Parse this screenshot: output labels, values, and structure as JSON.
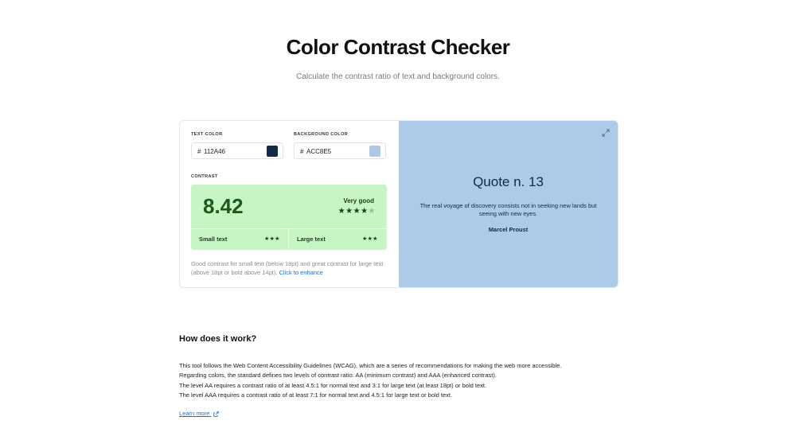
{
  "header": {
    "title": "Color Contrast Checker",
    "subtitle": "Calculate the contrast ratio of text and background colors."
  },
  "inputs": {
    "text_color_label": "TEXT COLOR",
    "text_color_hash": "#",
    "text_color_value": "112A46",
    "text_color_swatch": "#112a46",
    "background_color_label": "BACKGROUND COLOR",
    "background_color_hash": "#",
    "background_color_value": "ACC8E5",
    "background_color_swatch": "#acc8e5"
  },
  "contrast": {
    "label": "CONTRAST",
    "ratio": "8.42",
    "rating": "Very good",
    "stars_filled": 4,
    "stars_total": 5,
    "small_text_label": "Small text",
    "small_text_stars": "★★★",
    "large_text_label": "Large text",
    "large_text_stars": "★★★",
    "panel_color": "#c7f5c3"
  },
  "note": {
    "text": "Good contrast for small text (below 18pt) and great contrast for large text (above 18pt or bold above 14pt).",
    "link": "Click to enhance"
  },
  "preview": {
    "title": "Quote n. 13",
    "text": "The real voyage of discovery consists not in seeking new lands but seeing with new eyes.",
    "author": "Marcel Proust",
    "expand_icon": "expand-icon"
  },
  "how": {
    "title": "How does it work?",
    "lines": [
      "This tool follows the Web Content Accessibility Guidelines (WCAG), which are a series of recommendations for making the web more accessible.",
      "Regarding colors, the standard defines two levels of contrast ratio: AA (minimum contrast) and AAA (enhanced contrast).",
      "The level AA requires a contrast ratio of at least 4.5:1 for normal text and 3:1 for large text (at least 18pt) or bold text.",
      "The level AAA requires a contrast ratio of at least 7:1 for normal text and 4.5:1 for large text or bold text."
    ],
    "learn_more": "Learn more",
    "learn_more_icon": "external-link-icon"
  }
}
